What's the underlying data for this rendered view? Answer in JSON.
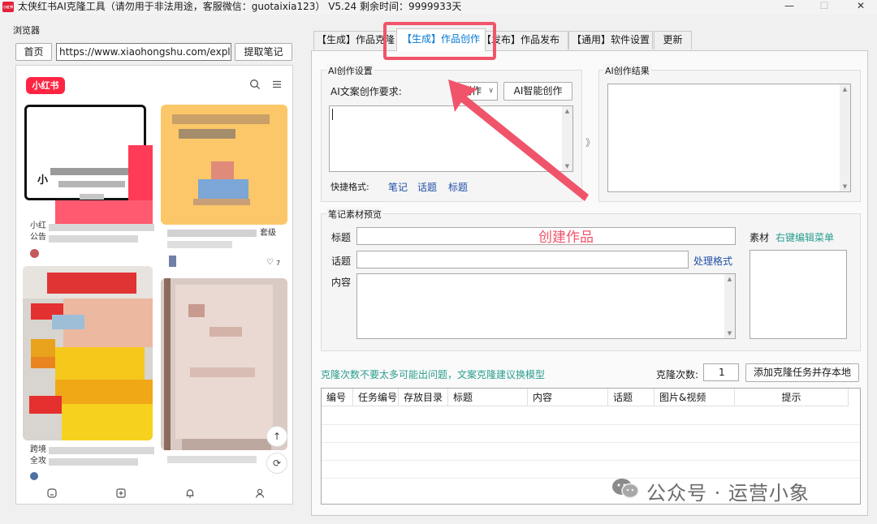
{
  "window": {
    "app_icon_text": "小红书",
    "title": "太侠红书AI克隆工具（请勿用于非法用途，客服微信：guotaixia123）  V5.24 剩余时间：9999933天",
    "minimize": "—",
    "maximize": "☐",
    "close": "✕"
  },
  "browser": {
    "label": "浏览器",
    "home_button": "首页",
    "url_value": "https://www.xiaohongshu.com/explore",
    "extract_button": "提取笔记",
    "logo_text": "小红书",
    "card1_text": "小",
    "card3_caption_top": "小红",
    "card3_caption_bottom": "公告",
    "card4_caption_tail": "套级",
    "card4_likes": "7",
    "card5_caption_top": "跨境",
    "card5_caption_bottom": "全攻"
  },
  "tabs": [
    {
      "label": "【生成】作品克隆"
    },
    {
      "label": "【生成】作品创作"
    },
    {
      "label": "【发布】作品发布"
    },
    {
      "label": "【通用】软件设置"
    },
    {
      "label": "更新"
    }
  ],
  "ai_settings": {
    "title": "AI创作设置",
    "requirement_label": "AI文案创作要求:",
    "mode_select": "创作",
    "ai_button": "AI智能创作",
    "quick_label": "快捷格式:",
    "quick_links": [
      "笔记",
      "话题",
      "标题"
    ]
  },
  "ai_result": {
    "title": "AI创作结果",
    "arrow": "》"
  },
  "preview": {
    "title": "笔记素材预览",
    "title_label": "标题",
    "topic_label": "话题",
    "content_label": "内容",
    "process_link": "处理格式",
    "material_label": "素材",
    "material_hint": "右键编辑菜单"
  },
  "clone": {
    "warning": "克隆次数不要太多可能出问题，文案克隆建议换模型",
    "count_label": "克隆次数:",
    "count_value": "1",
    "add_button": "添加克隆任务并存本地"
  },
  "table": {
    "columns": [
      "编号",
      "任务编号",
      "存放目录",
      "标题",
      "内容",
      "话题",
      "图片&视频",
      "提示"
    ]
  },
  "annotation": {
    "callout": "创建作品"
  },
  "watermark": {
    "text": "公众号 · 运营小象"
  },
  "colors": {
    "accent": "#0078d4",
    "brand": "#ff2442",
    "highlight": "#f0546b",
    "teal": "#2a9d8f",
    "link": "#1f4fa8"
  }
}
